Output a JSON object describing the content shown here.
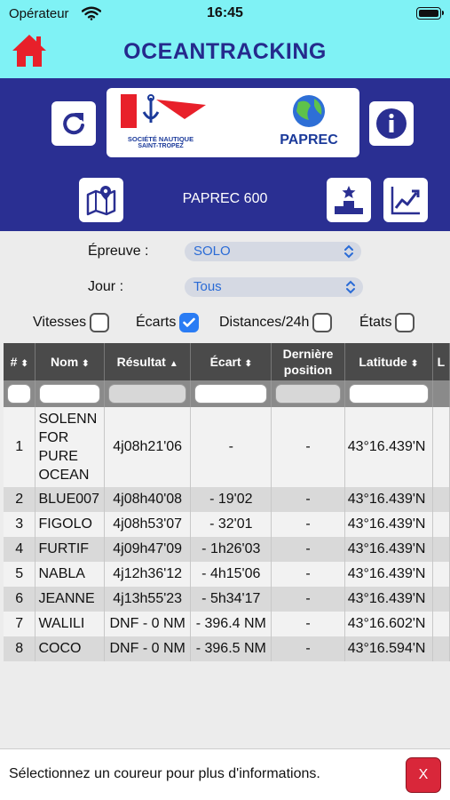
{
  "status_bar": {
    "carrier": "Opérateur",
    "time": "16:45"
  },
  "header": {
    "title": "OCEANTRACKING"
  },
  "logos": {
    "club_line1": "SOCIÉTÉ NAUTIQUE",
    "club_line2": "SAINT-TROPEZ",
    "sponsor": "PAPREC"
  },
  "event": {
    "name": "PAPREC 600"
  },
  "filters": {
    "epreuve_label": "Épreuve :",
    "epreuve_value": "SOLO",
    "jour_label": "Jour :",
    "jour_value": "Tous",
    "checkboxes": [
      {
        "label": "Vitesses",
        "checked": false
      },
      {
        "label": "Écarts",
        "checked": true
      },
      {
        "label": "Distances/24h",
        "checked": false
      },
      {
        "label": "États",
        "checked": false
      }
    ]
  },
  "table": {
    "columns": [
      "#",
      "Nom",
      "Résultat",
      "Écart",
      "Dernière position",
      "Latitude"
    ],
    "rows": [
      {
        "rank": "1",
        "name": "SOLENN FOR PURE OCEAN",
        "result": "4j08h21'06",
        "gap": "-",
        "last_position": "-",
        "latitude": "43°16.439'N"
      },
      {
        "rank": "2",
        "name": "BLUE007",
        "result": "4j08h40'08",
        "gap": "- 19'02",
        "last_position": "-",
        "latitude": "43°16.439'N"
      },
      {
        "rank": "3",
        "name": "FIGOLO",
        "result": "4j08h53'07",
        "gap": "- 32'01",
        "last_position": "-",
        "latitude": "43°16.439'N"
      },
      {
        "rank": "4",
        "name": "FURTIF",
        "result": "4j09h47'09",
        "gap": "- 1h26'03",
        "last_position": "-",
        "latitude": "43°16.439'N"
      },
      {
        "rank": "5",
        "name": "NABLA",
        "result": "4j12h36'12",
        "gap": "- 4h15'06",
        "last_position": "-",
        "latitude": "43°16.439'N"
      },
      {
        "rank": "6",
        "name": "JEANNE",
        "result": "4j13h55'23",
        "gap": "- 5h34'17",
        "last_position": "-",
        "latitude": "43°16.439'N"
      },
      {
        "rank": "7",
        "name": "WALILI",
        "result": "DNF - 0 NM",
        "gap": "- 396.4 NM",
        "last_position": "-",
        "latitude": "43°16.602'N"
      },
      {
        "rank": "8",
        "name": "COCO",
        "result": "DNF - 0 NM",
        "gap": "- 396.5 NM",
        "last_position": "-",
        "latitude": "43°16.594'N"
      }
    ]
  },
  "footer": {
    "message": "Sélectionnez un coureur pour plus d'informations.",
    "close_label": "X"
  },
  "colors": {
    "accent_cyan": "#7ff2f5",
    "brand_navy": "#2a2f92",
    "checkbox_blue": "#2a7cf4",
    "close_red": "#d9273a"
  }
}
